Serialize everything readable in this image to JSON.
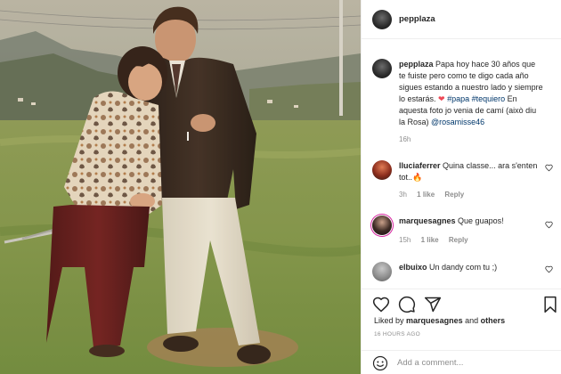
{
  "post": {
    "username": "pepplaza"
  },
  "caption": {
    "username": "pepplaza",
    "text_1": "Papa hoy hace 30 años que te fuiste pero como te digo cada año sigues estando a nuestro lado y siempre lo estarás. ",
    "heart": "❤",
    "hashtag_1": "#papa",
    "hashtag_2": "#tequiero",
    "text_2": " En aquesta foto jo venia de camí (això diu la Rosa) ",
    "mention": "@rosamisse46",
    "time": "16h"
  },
  "comments": [
    {
      "username": "lluciaferrer",
      "text": "Quina classe... ara s'enten tot..",
      "emoji": "🔥",
      "time": "3h",
      "likes": "1 like",
      "reply": "Reply"
    },
    {
      "username": "marquesagnes",
      "text": "Que guapos!",
      "time": "15h",
      "likes": "1 like",
      "reply": "Reply"
    },
    {
      "username": "elbuixo",
      "text": "Un dandy com tu ;)"
    }
  ],
  "likes_line": {
    "prefix": "Liked by",
    "user": "marquesagnes",
    "and": "and",
    "others": "others"
  },
  "timestamp": "16 HOURS AGO",
  "add_comment_placeholder": "Add a comment...",
  "icons": {
    "like": "heart-icon",
    "comment": "comment-icon",
    "share": "share-icon",
    "save": "bookmark-icon",
    "emoji": "emoji-icon"
  }
}
